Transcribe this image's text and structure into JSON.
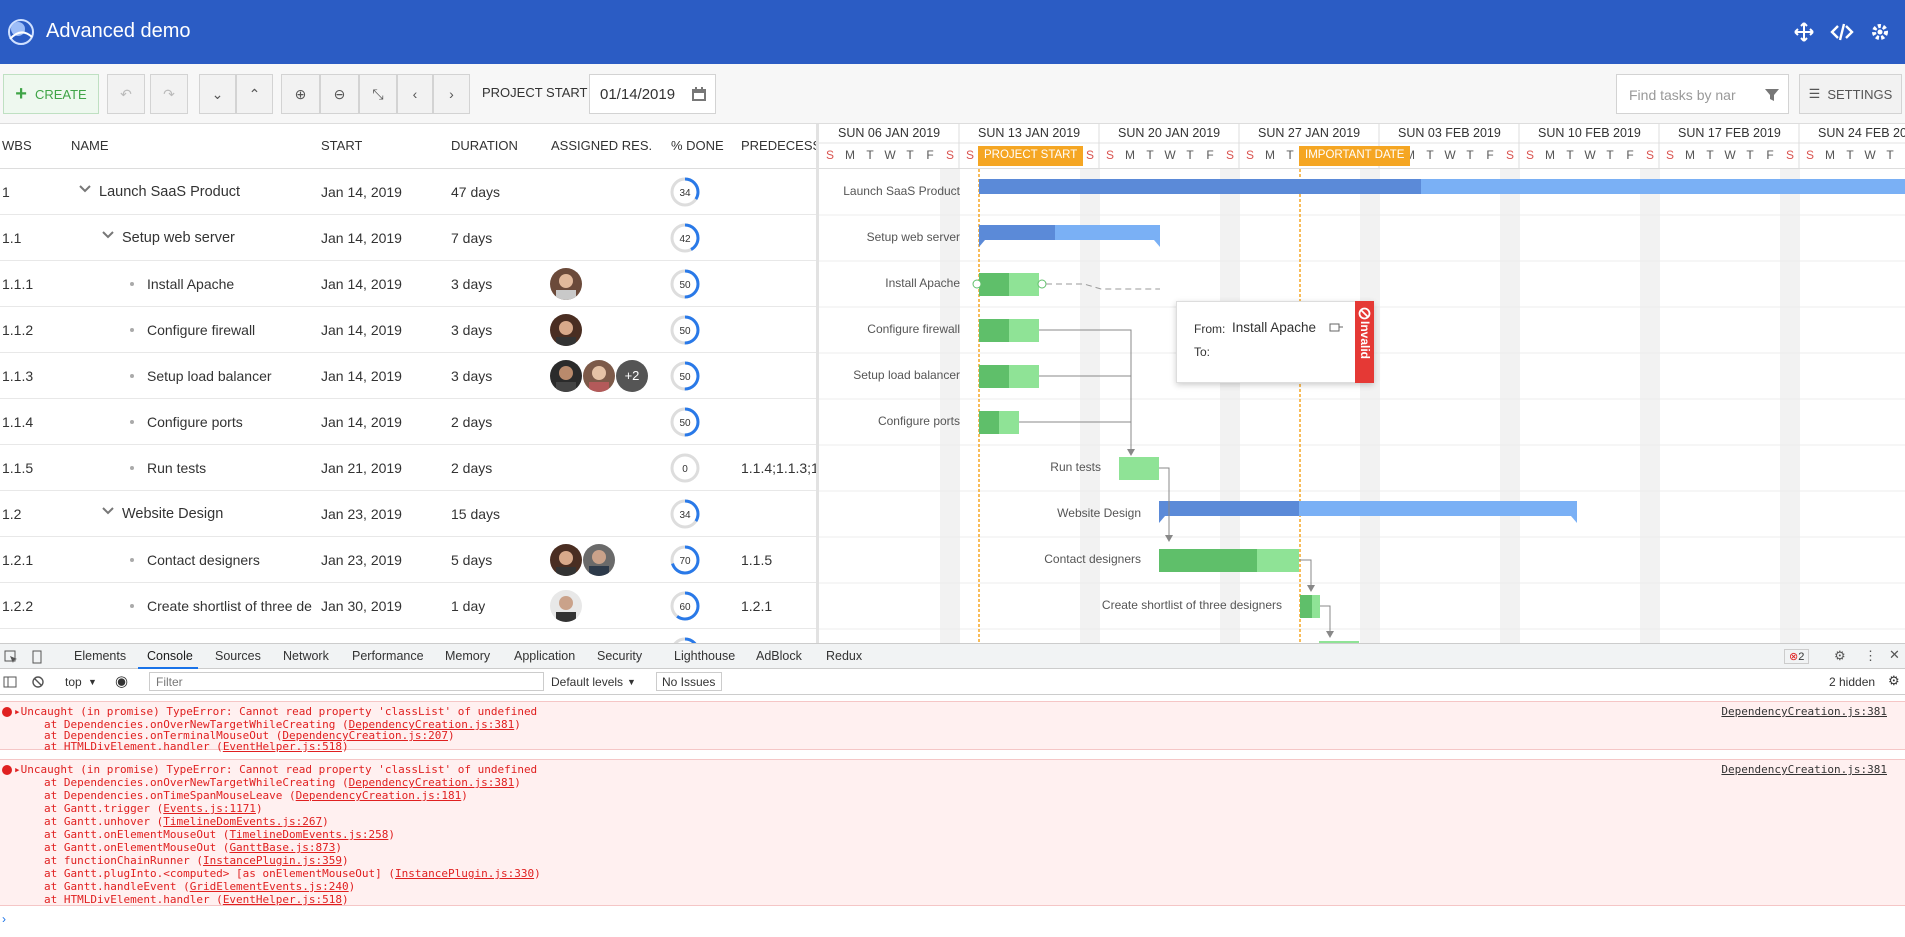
{
  "app": {
    "title": "Advanced demo"
  },
  "toolbar": {
    "create_label": "CREATE",
    "project_start_label": "PROJECT START",
    "project_start_value": "01/14/2019",
    "search_placeholder": "Find tasks by nar",
    "settings_label": "SETTINGS"
  },
  "grid": {
    "headers": {
      "wbs": "WBS",
      "name": "NAME",
      "start": "START",
      "duration": "DURATION",
      "resources": "ASSIGNED RES...",
      "done": "% DONE",
      "predecessors": "PREDECESSO"
    },
    "rows": [
      {
        "wbs": "1",
        "name": "Launch SaaS Product",
        "start": "Jan 14, 2019",
        "duration": "47 days",
        "done": "34",
        "pred": ""
      },
      {
        "wbs": "1.1",
        "name": "Setup web server",
        "start": "Jan 14, 2019",
        "duration": "7 days",
        "done": "42",
        "pred": ""
      },
      {
        "wbs": "1.1.1",
        "name": "Install Apache",
        "start": "Jan 14, 2019",
        "duration": "3 days",
        "done": "50",
        "pred": ""
      },
      {
        "wbs": "1.1.2",
        "name": "Configure firewall",
        "start": "Jan 14, 2019",
        "duration": "3 days",
        "done": "50",
        "pred": ""
      },
      {
        "wbs": "1.1.3",
        "name": "Setup load balancer",
        "start": "Jan 14, 2019",
        "duration": "3 days",
        "done": "50",
        "pred": "",
        "extra_resources": "+2"
      },
      {
        "wbs": "1.1.4",
        "name": "Configure ports",
        "start": "Jan 14, 2019",
        "duration": "2 days",
        "done": "50",
        "pred": ""
      },
      {
        "wbs": "1.1.5",
        "name": "Run tests",
        "start": "Jan 21, 2019",
        "duration": "2 days",
        "done": "0",
        "pred": "1.1.4;1.1.3;1"
      },
      {
        "wbs": "1.2",
        "name": "Website Design",
        "start": "Jan 23, 2019",
        "duration": "15 days",
        "done": "34",
        "pred": ""
      },
      {
        "wbs": "1.2.1",
        "name": "Contact designers",
        "start": "Jan 23, 2019",
        "duration": "5 days",
        "done": "70",
        "pred": "1.1.5"
      },
      {
        "wbs": "1.2.2",
        "name": "Create shortlist of three de",
        "start": "Jan 30, 2019",
        "duration": "1 day",
        "done": "60",
        "pred": "1.2.1"
      }
    ]
  },
  "timeline": {
    "weeks": [
      "SUN 06 JAN 2019",
      "SUN 13 JAN 2019",
      "SUN 20 JAN 2019",
      "SUN 27 JAN 2019",
      "SUN 03 FEB 2019",
      "SUN 10 FEB 2019",
      "SUN 17 FEB 2019",
      "SUN 24 FEB 20"
    ],
    "day_letters": [
      "S",
      "M",
      "T",
      "W",
      "T",
      "F",
      "S"
    ],
    "project_start_badge": "PROJECT START",
    "important_date_badge": "IMPORTANT DATE",
    "labels": [
      "Launch SaaS Product",
      "Setup web server",
      "Install Apache",
      "Configure firewall",
      "Setup load balancer",
      "Configure ports",
      "Run tests",
      "Website Design",
      "Contact designers",
      "Create shortlist of three designers"
    ]
  },
  "dependency_tooltip": {
    "from_label": "From:",
    "from_value": "Install Apache",
    "to_label": "To:",
    "invalid_label": "Invalid"
  },
  "devtools": {
    "tabs": [
      "Elements",
      "Console",
      "Sources",
      "Network",
      "Performance",
      "Memory",
      "Application",
      "Security",
      "Lighthouse",
      "AdBlock",
      "Redux"
    ],
    "active_tab": "Console",
    "error_count": "2",
    "context": "top",
    "filter_placeholder": "Filter",
    "levels": "Default levels",
    "issues": "No Issues",
    "hidden": "2 hidden",
    "errors": [
      {
        "message": "Uncaught (in promise) TypeError: Cannot read property 'classList' of undefined",
        "source": "DependencyCreation.js:381",
        "stack": [
          {
            "prefix": "at Dependencies.onOverNewTargetWhileCreating (",
            "file": "DependencyCreation.js:381",
            "suffix": ")"
          },
          {
            "prefix": "at Dependencies.onTerminalMouseOut (",
            "file": "DependencyCreation.js:207",
            "suffix": ")"
          },
          {
            "prefix": "at HTMLDivElement.handler (",
            "file": "EventHelper.js:518",
            "suffix": ")"
          }
        ]
      },
      {
        "message": "Uncaught (in promise) TypeError: Cannot read property 'classList' of undefined",
        "source": "DependencyCreation.js:381",
        "stack": [
          {
            "prefix": "at Dependencies.onOverNewTargetWhileCreating (",
            "file": "DependencyCreation.js:381",
            "suffix": ")"
          },
          {
            "prefix": "at Dependencies.onTimeSpanMouseLeave (",
            "file": "DependencyCreation.js:181",
            "suffix": ")"
          },
          {
            "prefix": "at Gantt.trigger (",
            "file": "Events.js:1171",
            "suffix": ")"
          },
          {
            "prefix": "at Gantt.unhover (",
            "file": "TimelineDomEvents.js:267",
            "suffix": ")"
          },
          {
            "prefix": "at Gantt.onElementMouseOut (",
            "file": "TimelineDomEvents.js:258",
            "suffix": ")"
          },
          {
            "prefix": "at Gantt.onElementMouseOut (",
            "file": "GanttBase.js:873",
            "suffix": ")"
          },
          {
            "prefix": "at functionChainRunner (",
            "file": "InstancePlugin.js:359",
            "suffix": ")"
          },
          {
            "prefix": "at Gantt.plugInto.<computed> [as onElementMouseOut] (",
            "file": "InstancePlugin.js:330",
            "suffix": ")"
          },
          {
            "prefix": "at Gantt.handleEvent (",
            "file": "GridElementEvents.js:240",
            "suffix": ")"
          },
          {
            "prefix": "at HTMLDivElement.handler (",
            "file": "EventHelper.js:518",
            "suffix": ")"
          }
        ]
      }
    ]
  },
  "colors": {
    "header_bg": "#2b5cc4",
    "parent_bar": "#5b8ad8",
    "parent_bar_light": "#7ab0f5",
    "leaf_bar": "#5fbf6a",
    "leaf_bar_light": "#8fe396",
    "badge": "#f5a623",
    "invalid": "#e53935",
    "error_text": "#e02020"
  }
}
